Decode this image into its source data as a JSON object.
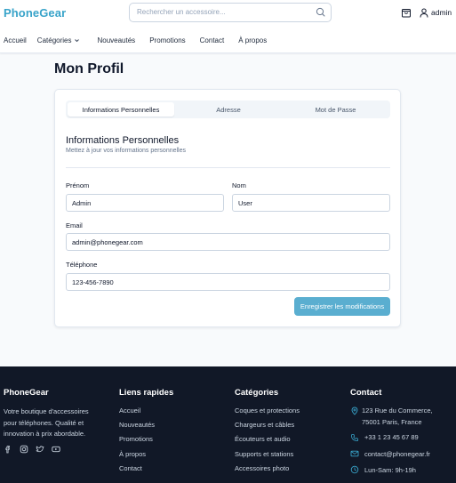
{
  "header": {
    "logo": "PhoneGear",
    "search_placeholder": "Rechercher un accessoire...",
    "user_name": "admin"
  },
  "nav": {
    "items": [
      "Accueil",
      "Catégories",
      "Nouveautés",
      "Promotions",
      "Contact",
      "À propos"
    ]
  },
  "page": {
    "title": "Mon Profil"
  },
  "tabs": [
    "Informations Personnelles",
    "Adresse",
    "Mot de Passe"
  ],
  "form": {
    "section_title": "Informations Personnelles",
    "section_subtitle": "Mettez à jour vos informations personnelles",
    "first_name_label": "Prénom",
    "first_name_value": "Admin",
    "last_name_label": "Nom",
    "last_name_value": "User",
    "email_label": "Email",
    "email_value": "admin@phonegear.com",
    "phone_label": "Téléphone",
    "phone_value": "123-456-7890",
    "save_label": "Enregistrer les modifications"
  },
  "footer": {
    "brand": {
      "title": "PhoneGear",
      "description_lines": [
        "Votre boutique d'accessoires",
        "pour téléphones. Qualité et",
        "innovation à prix abordable."
      ]
    },
    "quick_links": {
      "title": "Liens rapides",
      "items": [
        "Accueil",
        "Nouveautés",
        "Promotions",
        "À propos",
        "Contact"
      ]
    },
    "categories": {
      "title": "Catégories",
      "items": [
        "Coques et protections",
        "Chargeurs et câbles",
        "Écouteurs et audio",
        "Supports et stations",
        "Accessoires photo"
      ]
    },
    "contact": {
      "title": "Contact",
      "address_line1": "123 Rue du Commerce,",
      "address_line2": "75001 Paris, France",
      "phone": "+33 1 23 45 67 89",
      "email": "contact@phonegear.fr",
      "hours": "Lun-Sam: 9h-19h"
    }
  },
  "colors": {
    "accent": "#38a3c9",
    "button": "#5aaed0",
    "footer_bg": "#111827"
  }
}
